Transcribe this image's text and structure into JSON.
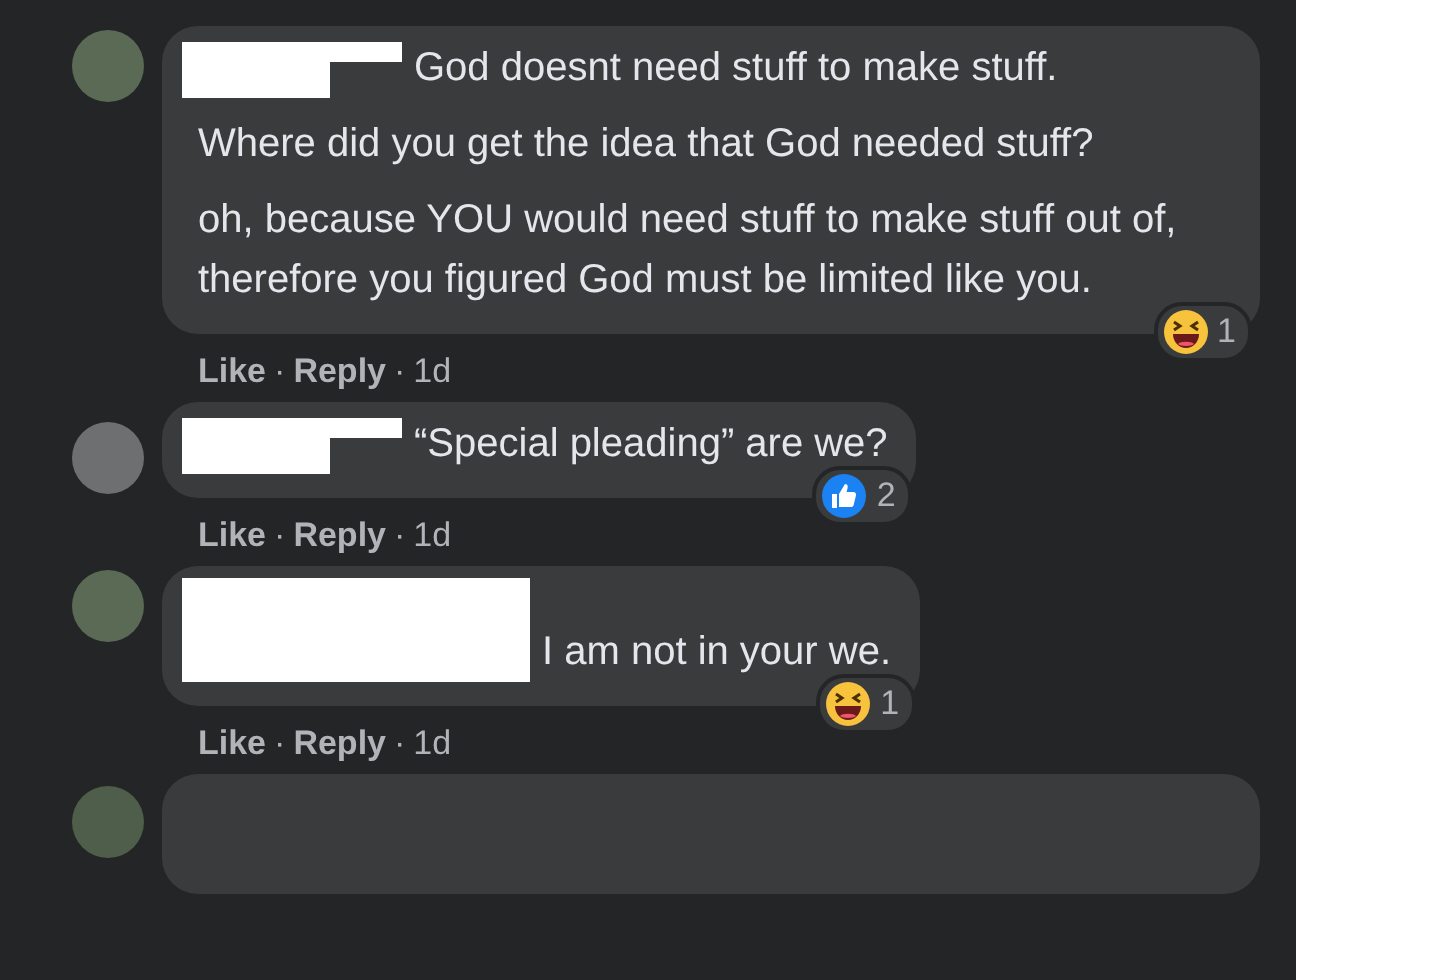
{
  "separator": "·",
  "comments": [
    {
      "redaction": {
        "kind": "two-line"
      },
      "paragraphs": [
        "God doesnt need stuff to make stuff.",
        "Where did you get the idea that God needed stuff?",
        "oh, because YOU would need stuff to make stuff out of, therefore you figured God must be limited like you."
      ],
      "reaction": {
        "kind": "haha",
        "count": "1"
      },
      "actions": [
        {
          "label": "Like",
          "kind": "link"
        },
        {
          "label": "Reply",
          "kind": "link"
        },
        {
          "label": "1d",
          "kind": "time"
        }
      ]
    },
    {
      "redaction": {
        "kind": "two-line"
      },
      "paragraphs": [
        "“Special pleading” are we?"
      ],
      "reaction": {
        "kind": "like",
        "count": "2"
      },
      "actions": [
        {
          "label": "Like",
          "kind": "link"
        },
        {
          "label": "Reply",
          "kind": "link"
        },
        {
          "label": "1d",
          "kind": "time"
        }
      ]
    },
    {
      "redaction": {
        "kind": "block"
      },
      "paragraphs": [
        "I am not in your we."
      ],
      "reaction": {
        "kind": "haha",
        "count": "1"
      },
      "actions": [
        {
          "label": "Like",
          "kind": "link"
        },
        {
          "label": "Reply",
          "kind": "link"
        },
        {
          "label": "1d",
          "kind": "time"
        }
      ]
    }
  ]
}
